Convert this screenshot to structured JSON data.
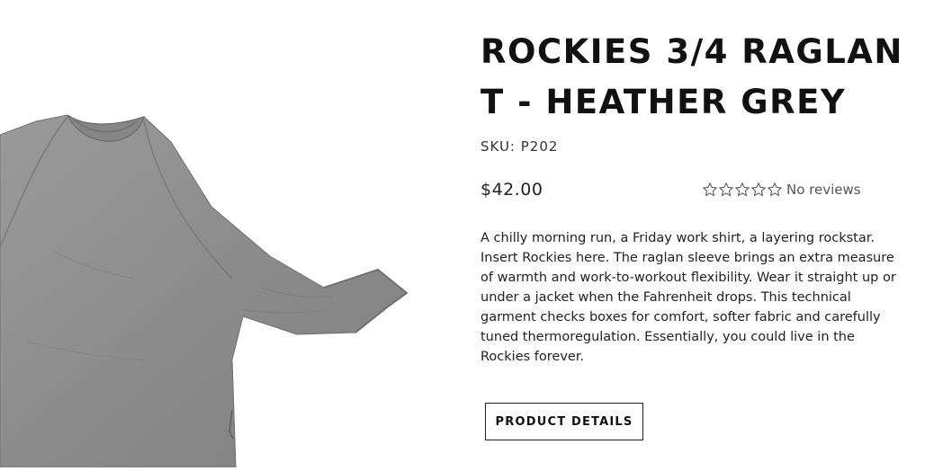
{
  "product": {
    "title": "ROCKIES 3/4 RAGLAN T - HEATHER GREY",
    "sku": "SKU: P202",
    "price": "$42.00",
    "reviews": {
      "rating": 0,
      "max_rating": 5,
      "label": "No reviews"
    },
    "description": "A chilly morning run, a Friday work shirt, a layering rockstar. Insert Rockies here. The raglan sleeve brings an extra measure of warmth and work-to-workout flexibility. Wear it straight up or under a jacket when the Fahrenheit drops. This technical garment checks boxes for comfort, softer fabric and carefully tuned thermoregulation. Essentially, you could live in the Rockies forever.",
    "details_button_label": "PRODUCT DETAILS",
    "image": {
      "subject": "heather grey 3/4 raglan t-shirt",
      "color": "#8e8e8e"
    }
  }
}
